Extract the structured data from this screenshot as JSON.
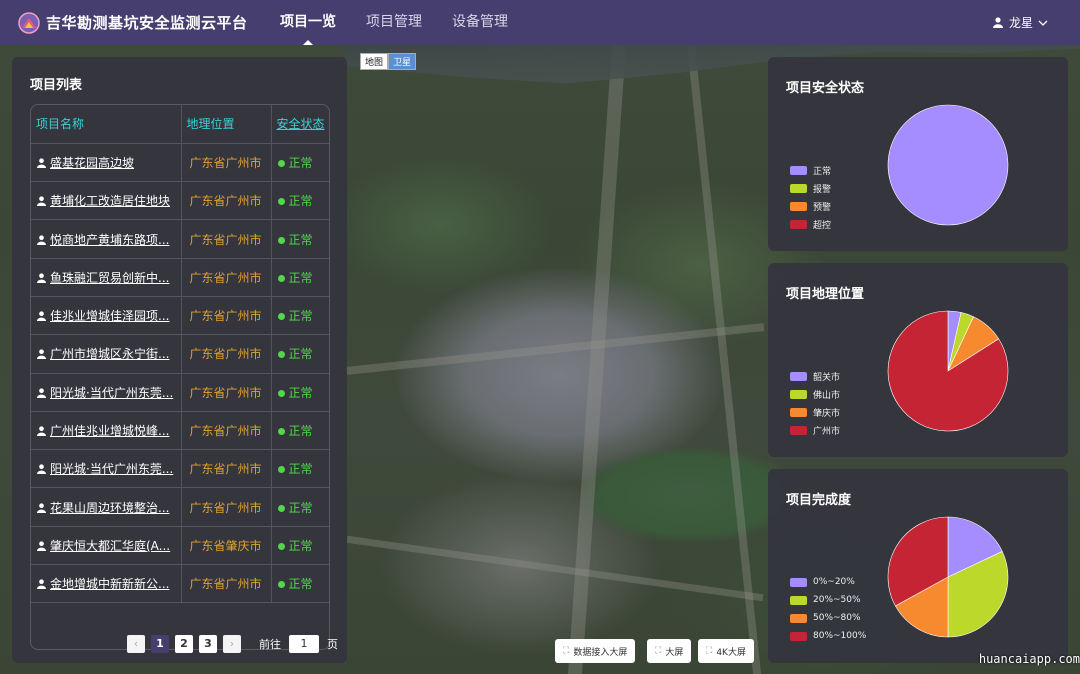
{
  "header": {
    "app_title": "吉华勘测基坑安全监测云平台",
    "nav": [
      {
        "label": "项目一览",
        "active": true
      },
      {
        "label": "项目管理",
        "active": false
      },
      {
        "label": "设备管理",
        "active": false
      }
    ],
    "user_name": "龙星"
  },
  "map": {
    "type_map_label": "地图",
    "type_satellite_label": "卫星",
    "selected": "卫星"
  },
  "project_list": {
    "title": "项目列表",
    "columns": [
      "项目名称",
      "地理位置",
      "安全状态"
    ],
    "rows": [
      {
        "name": "盛基花园高边坡",
        "location": "广东省广州市",
        "status": "正常"
      },
      {
        "name": "黄埔化工改造居住地块",
        "location": "广东省广州市",
        "status": "正常"
      },
      {
        "name": "悦商地产黄埔东路项...",
        "location": "广东省广州市",
        "status": "正常"
      },
      {
        "name": "鱼珠融汇贸易创新中...",
        "location": "广东省广州市",
        "status": "正常"
      },
      {
        "name": "佳兆业增城佳泽园项...",
        "location": "广东省广州市",
        "status": "正常"
      },
      {
        "name": "广州市增城区永宁街...",
        "location": "广东省广州市",
        "status": "正常"
      },
      {
        "name": "阳光城·当代广州东莞...",
        "location": "广东省广州市",
        "status": "正常"
      },
      {
        "name": "广州佳兆业增城悦峰...",
        "location": "广东省广州市",
        "status": "正常"
      },
      {
        "name": "阳光城·当代广州东莞...",
        "location": "广东省广州市",
        "status": "正常"
      },
      {
        "name": "花果山周边环境整治...",
        "location": "广东省广州市",
        "status": "正常"
      },
      {
        "name": "肇庆恒大都汇华庭(A...",
        "location": "广东省肇庆市",
        "status": "正常"
      },
      {
        "name": "金地增城中新新新公...",
        "location": "广东省广州市",
        "status": "正常"
      }
    ],
    "pagination": {
      "prev": "‹",
      "pages": [
        "1",
        "2",
        "3"
      ],
      "current": "1",
      "next": "›",
      "goto_label": "前往",
      "goto_value": "1",
      "page_unit": "页"
    }
  },
  "charts": {
    "safety": {
      "title": "项目安全状态",
      "legend": [
        {
          "label": "正常",
          "color": "#a58cff"
        },
        {
          "label": "报警",
          "color": "#bcd82a"
        },
        {
          "label": "预警",
          "color": "#f7892f"
        },
        {
          "label": "超控",
          "color": "#c42434"
        }
      ]
    },
    "location": {
      "title": "项目地理位置",
      "legend": [
        {
          "label": "韶关市",
          "color": "#a58cff"
        },
        {
          "label": "佛山市",
          "color": "#bcd82a"
        },
        {
          "label": "肇庆市",
          "color": "#f7892f"
        },
        {
          "label": "广州市",
          "color": "#c42434"
        }
      ]
    },
    "completion": {
      "title": "项目完成度",
      "legend": [
        {
          "label": "0%~20%",
          "color": "#a58cff"
        },
        {
          "label": "20%~50%",
          "color": "#bcd82a"
        },
        {
          "label": "50%~80%",
          "color": "#f7892f"
        },
        {
          "label": "80%~100%",
          "color": "#c42434"
        }
      ]
    }
  },
  "chart_data": [
    {
      "type": "pie",
      "title": "项目安全状态",
      "categories": [
        "正常",
        "报警",
        "预警",
        "超控"
      ],
      "values": [
        100,
        0,
        0,
        0
      ],
      "colors": [
        "#a58cff",
        "#bcd82a",
        "#f7892f",
        "#c42434"
      ]
    },
    {
      "type": "pie",
      "title": "项目地理位置",
      "categories": [
        "韶关市",
        "佛山市",
        "肇庆市",
        "广州市"
      ],
      "values": [
        3.5,
        3.5,
        9,
        84
      ],
      "colors": [
        "#a58cff",
        "#bcd82a",
        "#f7892f",
        "#c42434"
      ]
    },
    {
      "type": "pie",
      "title": "项目完成度",
      "categories": [
        "0%~20%",
        "20%~50%",
        "50%~80%",
        "80%~100%"
      ],
      "values": [
        18,
        32,
        17,
        33
      ],
      "colors": [
        "#a58cff",
        "#bcd82a",
        "#f7892f",
        "#c42434"
      ]
    }
  ],
  "bottom_buttons": [
    {
      "label": "数据接入大屏"
    },
    {
      "label": "大屏"
    },
    {
      "label": "4K大屏"
    }
  ],
  "watermark": "huancaiapp.com"
}
